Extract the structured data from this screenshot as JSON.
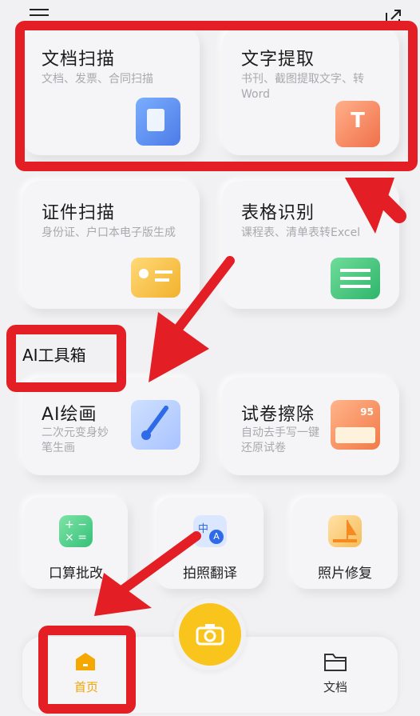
{
  "topbar": {
    "menu_icon": "menu-icon",
    "share_icon": "share-icon"
  },
  "cards": {
    "doc_scan": {
      "title": "文档扫描",
      "sub": "文档、发票、合同扫描"
    },
    "text_extract": {
      "title": "文字提取",
      "sub": "书刊、截图提取文字、转Word"
    },
    "id_scan": {
      "title": "证件扫描",
      "sub": "身份证、户口本电子版生成"
    },
    "table_recog": {
      "title": "表格识别",
      "sub": "课程表、清单表转Excel"
    },
    "ai_paint": {
      "title": "AI绘画",
      "sub": "二次元变身妙笔生画"
    },
    "paper_erase": {
      "title": "试卷擦除",
      "sub": "自动去手写一键还原试卷"
    }
  },
  "section": {
    "ai_toolbox": "AI工具箱"
  },
  "small_tools": [
    {
      "label": "口算批改",
      "icon": "math-grading-icon"
    },
    {
      "label": "拍照翻译",
      "icon": "translate-icon"
    },
    {
      "label": "照片修复",
      "icon": "photo-repair-icon"
    }
  ],
  "paper_score": "95",
  "tabs": {
    "home": "首页",
    "docs": "文档"
  },
  "colors": {
    "highlight_red": "#e31e24",
    "accent_yellow": "#f9c51c",
    "home_tab": "#f0a500"
  }
}
